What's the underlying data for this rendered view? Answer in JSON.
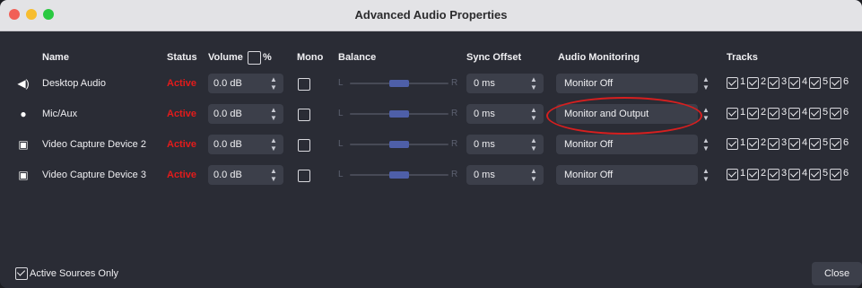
{
  "window": {
    "title": "Advanced Audio Properties"
  },
  "headers": {
    "name": "Name",
    "status": "Status",
    "volume": "Volume",
    "volume_unit": "%",
    "mono": "Mono",
    "balance": "Balance",
    "sync_offset": "Sync Offset",
    "audio_monitoring": "Audio Monitoring",
    "tracks": "Tracks"
  },
  "rows": [
    {
      "icon": "speaker-icon",
      "name": "Desktop Audio",
      "status": "Active",
      "volume": "0.0 dB",
      "mono": false,
      "balance_left": "L",
      "balance_right": "R",
      "balance": 0.5,
      "sync_offset": "0 ms",
      "monitoring": "Monitor Off",
      "tracks": [
        "1",
        "2",
        "3",
        "4",
        "5",
        "6"
      ]
    },
    {
      "icon": "microphone-icon",
      "name": "Mic/Aux",
      "status": "Active",
      "volume": "0.0 dB",
      "mono": false,
      "balance_left": "L",
      "balance_right": "R",
      "balance": 0.5,
      "sync_offset": "0 ms",
      "monitoring": "Monitor and Output",
      "tracks": [
        "1",
        "2",
        "3",
        "4",
        "5",
        "6"
      ]
    },
    {
      "icon": "camera-icon",
      "name": "Video Capture Device 2",
      "status": "Active",
      "volume": "0.0 dB",
      "mono": false,
      "balance_left": "L",
      "balance_right": "R",
      "balance": 0.5,
      "sync_offset": "0 ms",
      "monitoring": "Monitor Off",
      "tracks": [
        "1",
        "2",
        "3",
        "4",
        "5",
        "6"
      ]
    },
    {
      "icon": "camera-icon",
      "name": "Video Capture Device 3",
      "status": "Active",
      "volume": "0.0 dB",
      "mono": false,
      "balance_left": "L",
      "balance_right": "R",
      "balance": 0.5,
      "sync_offset": "0 ms",
      "monitoring": "Monitor Off",
      "tracks": [
        "1",
        "2",
        "3",
        "4",
        "5",
        "6"
      ]
    }
  ],
  "footer": {
    "active_sources_only": "Active Sources Only",
    "active_sources_checked": true,
    "close_label": "Close"
  },
  "colors": {
    "status_active": "#e31b1b",
    "slider_handle": "#4e5fa8",
    "highlight_ring": "#d61f1f"
  }
}
